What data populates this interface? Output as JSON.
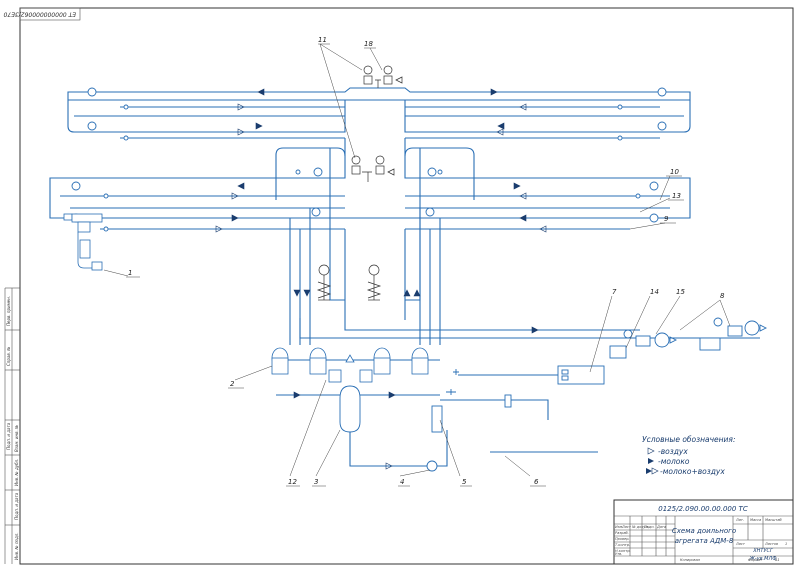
{
  "top_stamp": "ЕТ 000000000062/3Е70",
  "callouts": [
    "11",
    "18",
    "10",
    "13",
    "9",
    "1",
    "7",
    "14",
    "15",
    "8",
    "2",
    "12",
    "3",
    "4",
    "5",
    "6"
  ],
  "legend": {
    "title": "Условные обозначения:",
    "air": "-воздух",
    "milk": "-молоко",
    "milk_air": "-молоко+воздух"
  },
  "title_block": {
    "code": "0125/2.090.00.00.000 ТС",
    "title_line1": "Схема доильного",
    "title_line2": "агрегата АДМ-8",
    "org_line1": "ХНТУСГ",
    "org_line2": "Ж-ув.МЛФ",
    "hdr_lit": "Лит.",
    "hdr_mass": "Масса",
    "hdr_scale": "Масштаб",
    "hdr_sheet": "Лист",
    "hdr_sheets": "Листов",
    "sheets_val": "1",
    "rev_cols": [
      "Изм.",
      "Лист",
      "№ докум.",
      "Подп.",
      "Дата"
    ],
    "roles": [
      "Разраб.",
      "Провер.",
      "Т.контр.",
      "",
      "Н.контр.",
      "Утв."
    ],
    "copied": "Копировал",
    "format": "Формат",
    "format_val": "А1"
  },
  "side_labels": [
    "Перв. примен.",
    "Справ. №",
    "Подп. и дата",
    "Инв. № дубл.",
    "Взам. инв. №",
    "Подп. и дата",
    "Инв. № подл."
  ]
}
